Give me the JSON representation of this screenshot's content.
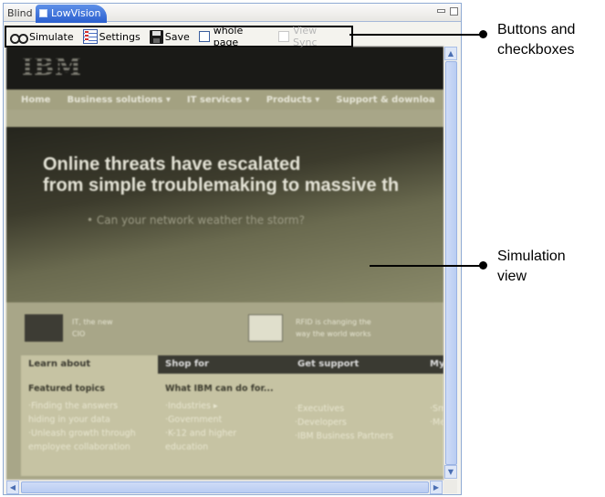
{
  "tabs": {
    "inactive_label": "Blind",
    "active_label": "LowVision"
  },
  "toolbar": {
    "simulate_label": "Simulate",
    "settings_label": "Settings",
    "save_label": "Save",
    "whole_page_label": "whole page",
    "view_sync_label": "View Sync"
  },
  "simulation": {
    "logo": "IBM",
    "nav": [
      "Home",
      "Business solutions ▾",
      "IT services ▾",
      "Products ▾",
      "Support & downloa"
    ],
    "hero_line1": "Online threats have escalated",
    "hero_line2": "from simple troublemaking to massive th",
    "hero_sub": "• Can your network weather the storm?",
    "teaser1": [
      "IT, the new",
      "CIO"
    ],
    "teaser2": [
      "RFID is changing the",
      "way the world works"
    ],
    "section_tabs": [
      "Learn about",
      "Shop for",
      "Get support",
      "My"
    ],
    "col1_head": "Featured topics",
    "col1_items": [
      "·Finding the answers",
      " hiding in your data",
      "·Unleash growth through",
      " employee collaboration"
    ],
    "col2_head": "What IBM can do for...",
    "col2_items": [
      "·Industries ▸",
      "·Government",
      "·K-12 and higher",
      " education"
    ],
    "col3_items": [
      "·Executives",
      "·Developers",
      "·IBM Business Partners"
    ],
    "col4_items": [
      "·Sm",
      "·Me"
    ]
  },
  "callouts": {
    "toolbar": [
      "Buttons and",
      "checkboxes"
    ],
    "simulation": [
      "Simulation",
      "view"
    ]
  }
}
